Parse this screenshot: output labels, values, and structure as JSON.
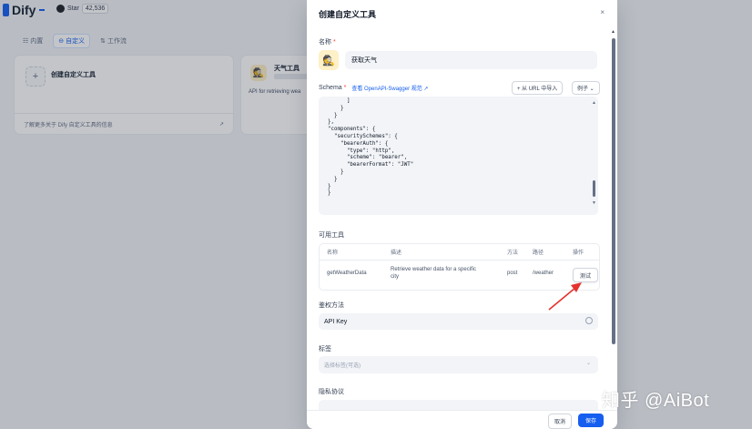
{
  "app": {
    "name": "Dify",
    "github_label": "Star",
    "github_count": "42,536"
  },
  "tabs": [
    {
      "label": "内置",
      "icon": "grid-icon",
      "active": false
    },
    {
      "label": "自定义",
      "icon": "bot-icon",
      "active": true
    },
    {
      "label": "工作流",
      "icon": "workflow-icon",
      "active": false
    }
  ],
  "create_card": {
    "plus": "+",
    "title": "创建自定义工具",
    "footer": "了解更多关于 Dify 自定义工具的信息",
    "footer_arrow": "↗"
  },
  "tool_card": {
    "avatar": "🕵",
    "name": "天气工具",
    "desc": "API for retrieving wea"
  },
  "modal": {
    "title": "创建自定义工具",
    "close": "×",
    "name_label": "名称",
    "required_mark": "*",
    "name_avatar": "🕵",
    "name_value": "获取天气",
    "schema_label": "Schema",
    "schema_link": "查看 OpenAPI-Swagger 规范 ↗",
    "url_button": "+ 从 URL 中导入",
    "example_button": "例子 ⌄",
    "code_lines": [
      "      ]",
      "    }",
      "  }",
      "},",
      "\"components\": {",
      "  \"securitySchemes\": {",
      "    \"bearerAuth\": {",
      "      \"type\": \"http\",",
      "      \"scheme\": \"bearer\",",
      "      \"bearerFormat\": \"JWT\"",
      "    }",
      "  }",
      "}",
      "}"
    ],
    "tools_label": "可用工具",
    "table_headers": [
      "名称",
      "描述",
      "方法",
      "路径",
      "操作"
    ],
    "table_rows": [
      {
        "name": "getWeatherData",
        "desc_line1": "Retrieve weather data for a specific",
        "desc_line2": "city",
        "method": "post",
        "path": "/weather",
        "action": "测试"
      }
    ],
    "auth_label": "鉴权方法",
    "auth_value": "API Key",
    "tags_label": "标签",
    "tags_placeholder": "选择标签(可选)",
    "privacy_label": "隐私协议",
    "cancel": "取消",
    "save": "保存"
  },
  "watermark": "知乎 @AiBot",
  "colors": {
    "primary": "#155eef",
    "annotation_arrow": "#e5322d",
    "required": "#f04438"
  }
}
